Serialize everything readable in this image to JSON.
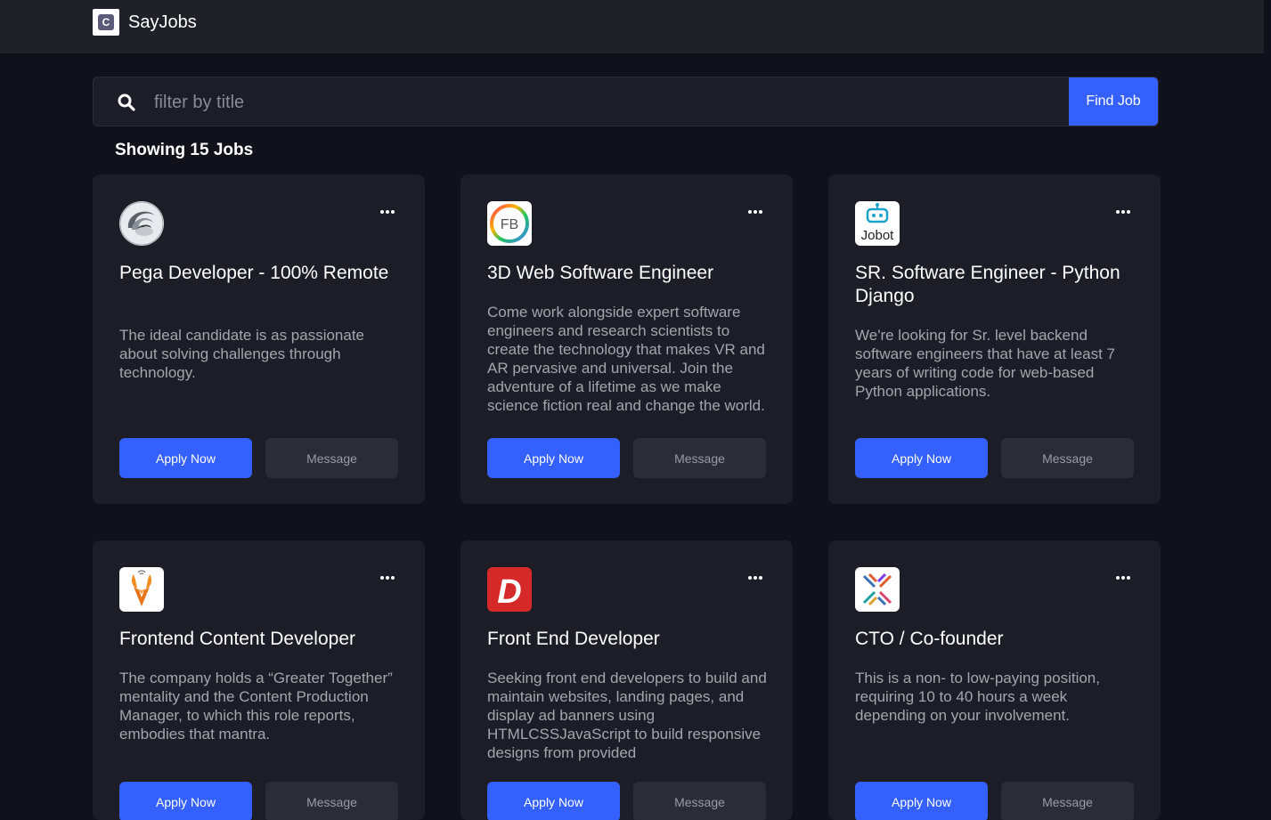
{
  "header": {
    "brand_name": "SayJobs",
    "brand_icon": "C"
  },
  "search": {
    "placeholder": "filter by title",
    "value": "",
    "button_label": "Find Job"
  },
  "results": {
    "count_label": "Showing 15 Jobs"
  },
  "colors": {
    "accent": "#3461fd",
    "card_bg": "#1c1d26",
    "page_bg": "#10111a"
  },
  "jobs": [
    {
      "logo": "pega-swirl-logo",
      "title": "Pega Developer - 100% Remote",
      "description": "The ideal candidate is as passionate about solving challenges through technology.",
      "apply_label": "Apply Now",
      "message_label": "Message"
    },
    {
      "logo": "fb-ring-logo",
      "logo_text": "FB",
      "title": "3D Web Software Engineer",
      "description": "Come work alongside expert software engineers and research scientists to create the technology that makes VR and AR pervasive and universal. Join the adventure of a lifetime as we make science fiction real and change the world.",
      "apply_label": "Apply Now",
      "message_label": "Message"
    },
    {
      "logo": "jobot-robot-logo",
      "logo_text": "Jobot",
      "title": "SR. Software Engineer - Python Django",
      "description": "We're looking for Sr. level backend software engineers that have at least 7 years of writing code for web-based Python applications.",
      "apply_label": "Apply Now",
      "message_label": "Message"
    },
    {
      "logo": "antelope-logo",
      "title": "Frontend Content Developer",
      "description": "The company holds a “Greater Together” mentality and the Content Production Manager, to which this role reports, embodies that mantra.",
      "apply_label": "Apply Now",
      "message_label": "Message"
    },
    {
      "logo": "red-d-logo",
      "logo_text": "D",
      "title": "Front End Developer",
      "description": "Seeking front end developers to build and maintain websites, landing pages, and display ad banners using HTMLCSSJavaScript to build responsive designs from provided",
      "apply_label": "Apply Now",
      "message_label": "Message"
    },
    {
      "logo": "cross-arrows-logo",
      "title": "CTO / Co-founder",
      "description": "This is a non- to low-paying position, requiring 10 to 40 hours a week depending on your involvement.",
      "apply_label": "Apply Now",
      "message_label": "Message"
    }
  ]
}
